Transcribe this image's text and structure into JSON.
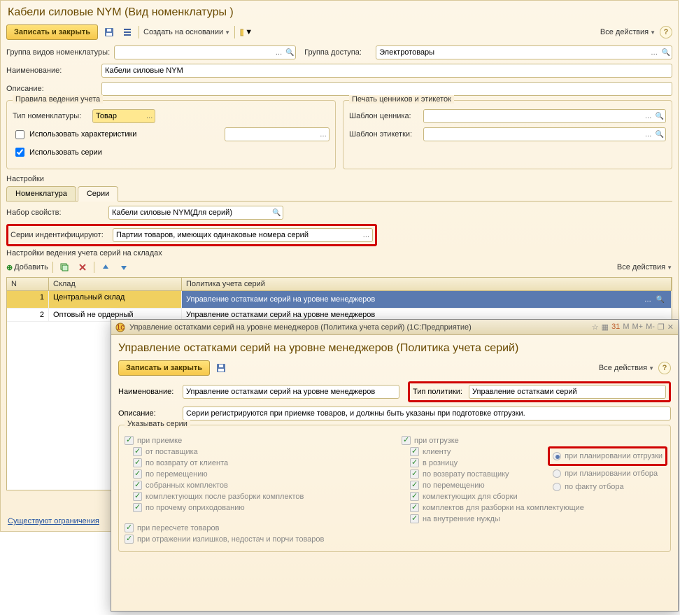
{
  "main": {
    "title": "Кабели силовые NYM (Вид номенклатуры )",
    "toolbar": {
      "save_close": "Записать и закрыть",
      "create_based": "Создать на основании",
      "all_actions": "Все действия"
    },
    "fields": {
      "group_types_label": "Группа видов номенклатуры:",
      "access_group_label": "Группа доступа:",
      "access_group_value": "Электротовары",
      "name_label": "Наименование:",
      "name_value": "Кабели силовые NYM",
      "desc_label": "Описание:",
      "desc_value": ""
    },
    "rules_box": {
      "legend": "Правила ведения учета",
      "type_label": "Тип номенклатуры:",
      "type_value": "Товар",
      "use_chars": "Использовать характеристики",
      "use_series": "Использовать серии"
    },
    "print_box": {
      "legend": "Печать ценников и этикеток",
      "price_tag_label": "Шаблон ценника:",
      "label_label": "Шаблон этикетки:"
    },
    "settings_label": "Настройки",
    "tabs": {
      "nomen": "Номенклатура",
      "series": "Серии"
    },
    "series_panel": {
      "prop_set_label": "Набор свойств:",
      "prop_set_value": "Кабели силовые NYM(Для серий)",
      "identify_label": "Серии индентифицируют:",
      "identify_value": "Партии товаров, имеющих одинаковые номера серий",
      "wh_settings_label": "Настройки ведения учета серий на складах",
      "add_btn": "Добавить",
      "all_actions": "Все действия",
      "headers": {
        "n": "N",
        "wh": "Склад",
        "policy": "Политика учета серий"
      },
      "rows": [
        {
          "n": "1",
          "wh": "Центральный склад",
          "policy": "Управление остатками серий на уровне менеджеров"
        },
        {
          "n": "2",
          "wh": "Оптовый не ордерный",
          "policy": "Управление остатками серий на уровне менеджеров"
        }
      ]
    },
    "footer_link": "Существуют ограничения"
  },
  "popup": {
    "window_title": "Управление остатками серий на уровне менеджеров (Политика учета серий)  (1С:Предприятие)",
    "title": "Управление остатками серий на уровне менеджеров (Политика учета серий)",
    "save_close": "Записать и закрыть",
    "all_actions": "Все действия",
    "name_label": "Наименование:",
    "name_value": "Управление остатками серий на уровне менеджеров",
    "policy_type_label": "Тип политики:",
    "policy_type_value": "Управление остатками серий",
    "desc_label": "Описание:",
    "desc_value": "Серии регистрируются при приемке товаров, и должны быть указаны при подготовке отгрузки.",
    "specify_legend": "Указывать серии",
    "left": {
      "on_receive": "при приемке",
      "from_supplier": "от поставщика",
      "return_from_client": "по возврату от клиента",
      "by_move": "по перемещению",
      "collected_kits": "собранных комплектов",
      "kit_parts_after": "комплектующих после разборки комплектов",
      "other_receipt": "по прочему оприходованию",
      "on_recount": "при пересчете товаров",
      "on_surplus": "при отражении излишков, недостач и порчи товаров"
    },
    "right": {
      "on_ship": "при отгрузке",
      "to_client": "клиенту",
      "retail": "в розницу",
      "return_to_supplier": "по возврату поставщику",
      "by_move": "по перемещению",
      "kit_parts_assembly": "комлектующих для сборки",
      "kits_for_disassembly": "комплектов для разборки на комплектующие",
      "internal": "на внутренние нужды",
      "radio_plan_ship": "при планировании отгрузки",
      "radio_plan_pick": "при планировании отбора",
      "radio_fact_pick": "по факту отбора"
    }
  }
}
